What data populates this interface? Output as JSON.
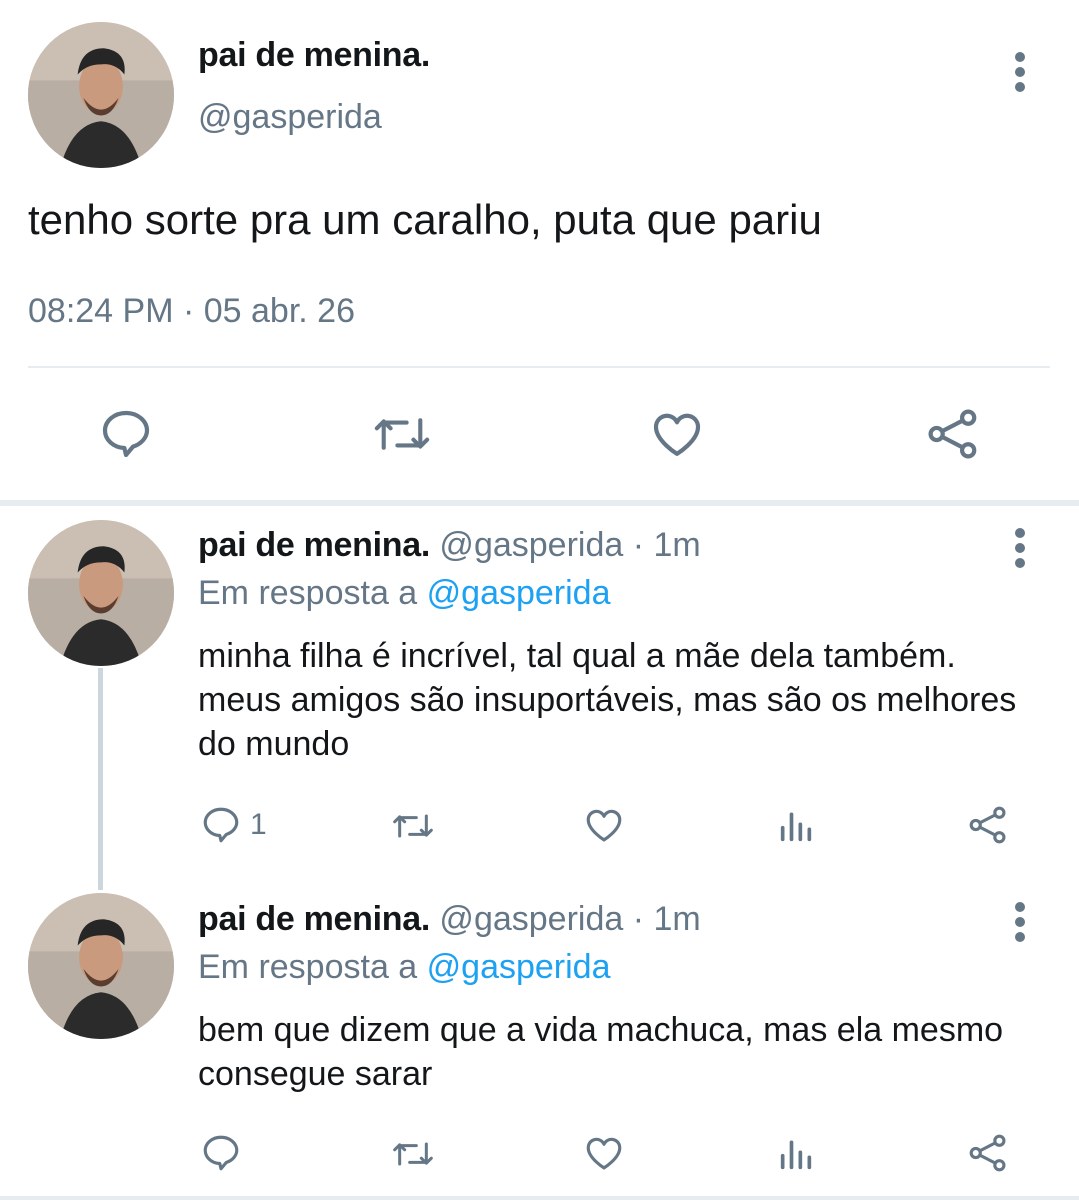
{
  "main_tweet": {
    "name": "pai de menina.",
    "handle": "@gasperida",
    "text": "tenho sorte pra um caralho, puta que pariu",
    "timestamp": "08:24 PM · 05 abr. 26"
  },
  "replies": [
    {
      "name": "pai de menina.",
      "meta": " @gasperida · 1m",
      "reply_prefix": "Em resposta a ",
      "reply_mention": "@gasperida",
      "text": "minha filha é incrível, tal qual a mãe dela também. meus amigos são insuportáveis, mas são os melhores do mundo",
      "reply_count": "1"
    },
    {
      "name": "pai de menina.",
      "meta": " @gasperida · 1m",
      "reply_prefix": "Em resposta a ",
      "reply_mention": "@gasperida",
      "text": "bem que dizem que a vida machuca, mas ela mesmo consegue sarar",
      "reply_count": ""
    }
  ],
  "colors": {
    "text": "#14171a",
    "secondary": "#657786",
    "link": "#1da1f2",
    "divider": "#e6ecf0",
    "thread_line": "#ccd6dd"
  },
  "icons": [
    "reply-icon",
    "retweet-icon",
    "like-icon",
    "share-icon",
    "analytics-icon",
    "more-options-icon"
  ]
}
